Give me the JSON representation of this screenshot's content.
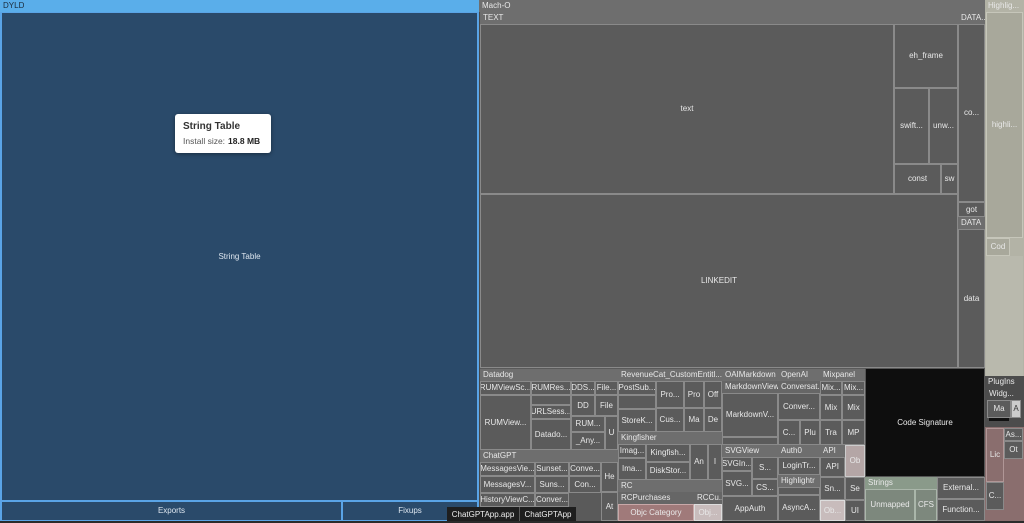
{
  "dyld": {
    "header": "DYLD",
    "string_table": "String Table",
    "exports": "Exports",
    "fixups": "Fixups"
  },
  "tooltip": {
    "title": "String Table",
    "label": "Install size:",
    "value": "18.8 MB"
  },
  "macho": {
    "header": "Mach-O",
    "text": "TEXT",
    "data_hdr": "DATA...",
    "text_cell": "text",
    "eh_frame": "eh_frame",
    "swift": "swift...",
    "unw": "unw...",
    "const": "const",
    "sw": "sw",
    "co": "co...",
    "got": "got",
    "data2": "DATA",
    "data": "data",
    "linkedit": "LINKEDIT",
    "code_signature": "Code Signature"
  },
  "highlight": {
    "header": "Highlig...",
    "cell": "highli...",
    "cod": "Cod"
  },
  "libs": {
    "datadog": "Datadog",
    "rumviewsc": "RUMViewSc...",
    "rumres": "RUMRes...",
    "dds": "DDS...",
    "file": "File...",
    "rumview": "RUMView...",
    "urlsess": "URLSess...",
    "dd": "DD",
    "file2": "File",
    "datado": "Datado...",
    "rum": "RUM...",
    "any": "_Any...",
    "u": "U",
    "revcat": "RevenueCat_CustomEntitl...",
    "postsub": "PostSub...",
    "pro1": "Pro...",
    "pro2": "Pro",
    "off": "Off",
    "storek": "StoreK...",
    "cus": "Cus...",
    "ma": "Ma",
    "de": "De",
    "kingfisher": "Kingfisher",
    "imag": "Imag...",
    "kingfish": "Kingfish...",
    "an": "An",
    "i": "I",
    "ima": "Ima...",
    "diskstor": "DiskStor...",
    "oaimarkdown": "OAIMarkdown",
    "markdownview": "MarkdownView",
    "markdownv": "MarkdownV...",
    "openai": "OpenAI",
    "conversat": "Conversat...",
    "conver": "Conver...",
    "c": "C...",
    "plu": "Plu",
    "tra": "Tra",
    "mixpanel": "Mixpanel",
    "mix1": "Mix...",
    "mix2": "Mix...",
    "mix3": "Mix",
    "mix4": "Mix",
    "mp": "MP",
    "chatgpt": "ChatGPT",
    "messagesvie": "MessagesVie...",
    "sunset": "Sunset...",
    "conve": "Conve...",
    "messagesv": "MessagesV...",
    "suns": "Suns...",
    "con": "Con...",
    "he": "He",
    "historyview": "HistoryViewC...",
    "conver2": "Conver...",
    "at": "At",
    "rc": "RC",
    "rcpurchases": "RCPurchases",
    "rccu": "RCCu...",
    "objc_category": "Objc Category",
    "obj": "Obj...",
    "svgview": "SVGView",
    "svgin": "SVGIn...",
    "s": "S...",
    "svg": "SVG...",
    "cs": "CS...",
    "auth0": "Auth0",
    "logintr": "LoginTr...",
    "highlightr": "Highlightr",
    "sn": "Sn...",
    "appauth": "AppAuth",
    "asynca": "AsyncA...",
    "ob": "Ob...",
    "api": "API",
    "api2": "API",
    "ob2": "Ob",
    "se": "Se",
    "ui": "UI",
    "strings": "Strings",
    "unmapped": "Unmapped",
    "cfs": "CFS",
    "external": "External...",
    "function": "Function...",
    "plugins": "PlugIns",
    "widg": "Widg...",
    "ma2": "Ma",
    "a": "A",
    "as": "As...",
    "lic": "Lic",
    "ot": "Ot",
    "cdots": "C..."
  },
  "breadcrumb": [
    "ChatGPTApp.app",
    "ChatGPTApp"
  ]
}
